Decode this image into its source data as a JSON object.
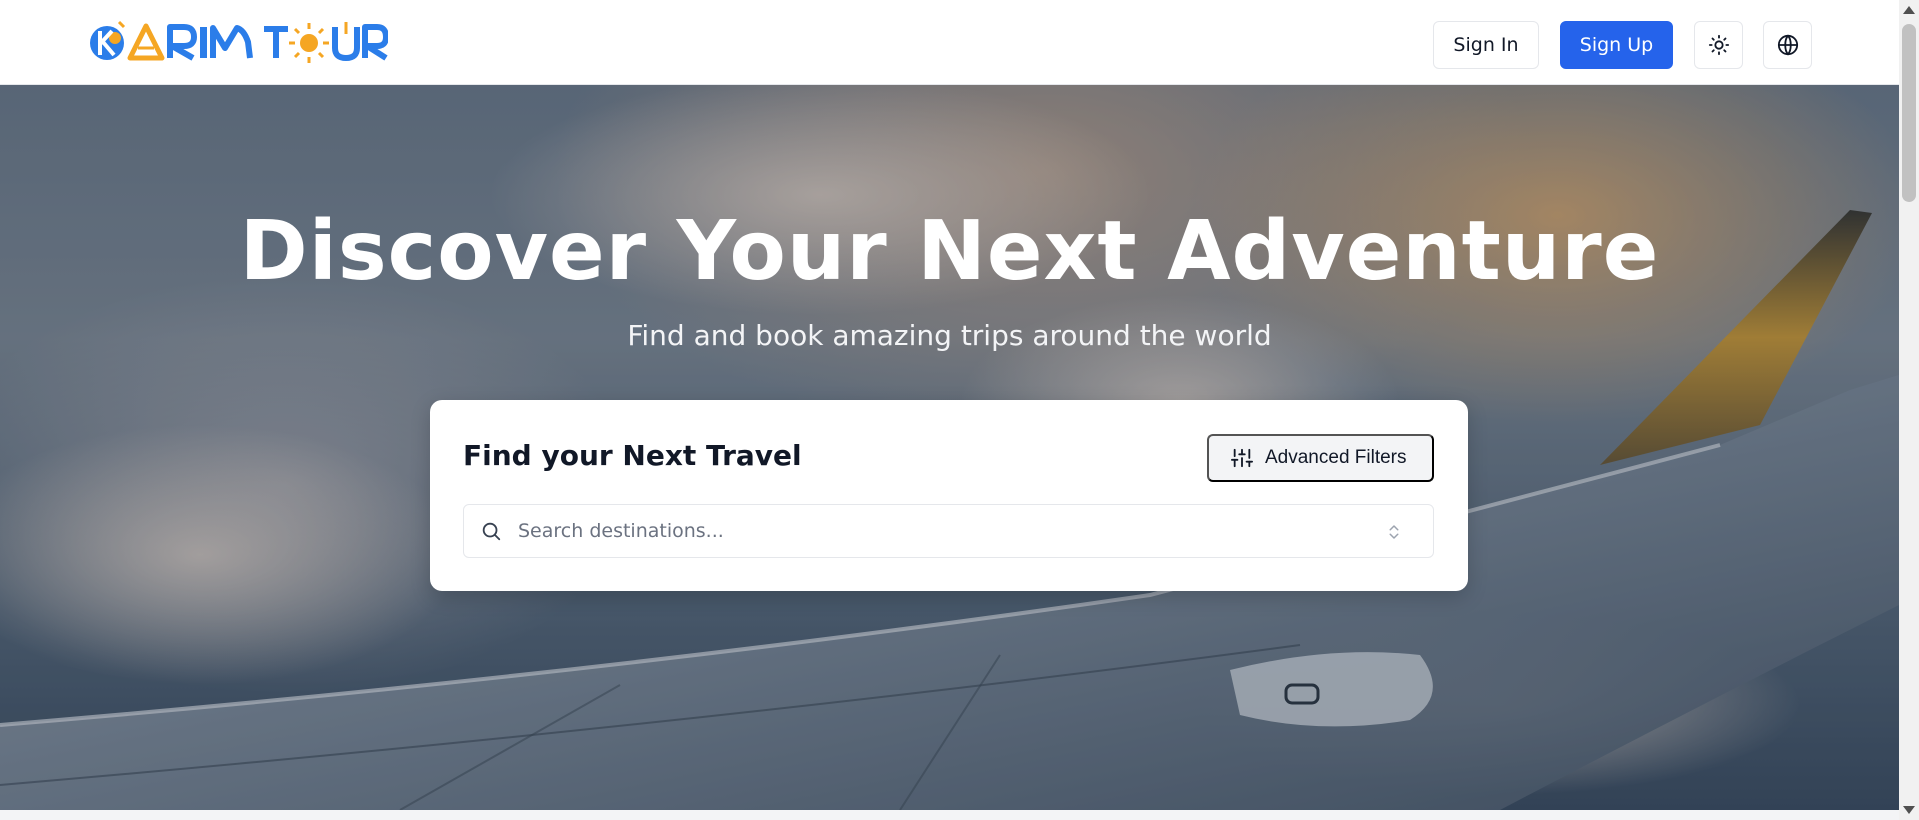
{
  "header": {
    "brand": "KARIM TOUR",
    "sign_in_label": "Sign In",
    "sign_up_label": "Sign Up",
    "theme_icon": "sun-icon",
    "language_icon": "globe-icon"
  },
  "hero": {
    "title": "Discover Your Next Adventure",
    "subtitle": "Find and book amazing trips around the world"
  },
  "search_card": {
    "title": "Find your Next Travel",
    "advanced_filters_label": "Advanced Filters",
    "filters_icon": "sliders-icon",
    "search_placeholder": "Search destinations...",
    "search_value": "",
    "search_icon": "search-icon",
    "select_icon": "chevrons-up-down-icon"
  },
  "colors": {
    "primary": "#2563eb",
    "logo_blue": "#2b7de9",
    "logo_orange": "#f5a623"
  }
}
